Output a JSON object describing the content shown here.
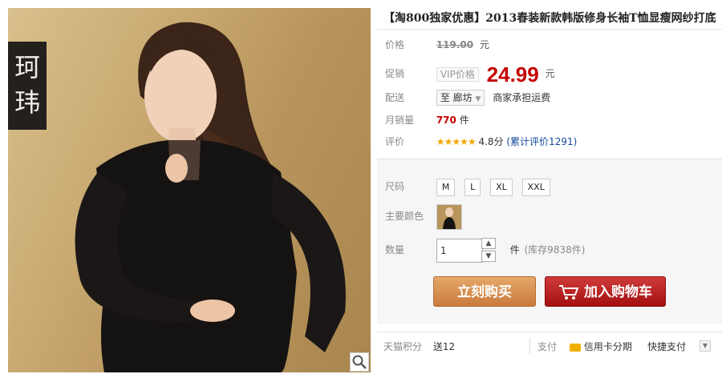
{
  "brand": {
    "line1": "珂",
    "line2": "玮"
  },
  "title": "【淘800独家优惠】2013春装新款韩版修身长袖T恤显瘦网纱打底",
  "price": {
    "label": "价格",
    "original": "119.00",
    "unit": "元"
  },
  "promo": {
    "label": "促销",
    "badge": "VIP价格",
    "value": "24.99",
    "unit": "元"
  },
  "shipping": {
    "label": "配送",
    "destination": "至 廊坊",
    "note": "商家承担运费"
  },
  "sales": {
    "label": "月销量",
    "count": "770",
    "unit": "件"
  },
  "rating": {
    "label": "评价",
    "stars": "★★★★★",
    "score": "4.8分",
    "reviews": "(累计评价1291)"
  },
  "sku": {
    "size_label": "尺码",
    "sizes": [
      "M",
      "L",
      "XL",
      "XXL"
    ],
    "color_label": "主要颜色"
  },
  "quantity": {
    "label": "数量",
    "value": "1",
    "unit": "件",
    "stock": "(库存9838件)"
  },
  "actions": {
    "buy": "立刻购买",
    "cart": "加入购物车"
  },
  "footer": {
    "points_label": "天猫积分",
    "points_value": "送12",
    "pay_label": "支付",
    "credit": "信用卡分期",
    "quick": "快捷支付"
  },
  "colors": {
    "price_red": "#c40000",
    "cart_red": "#b41515",
    "buy_orange": "#d88a4c"
  }
}
